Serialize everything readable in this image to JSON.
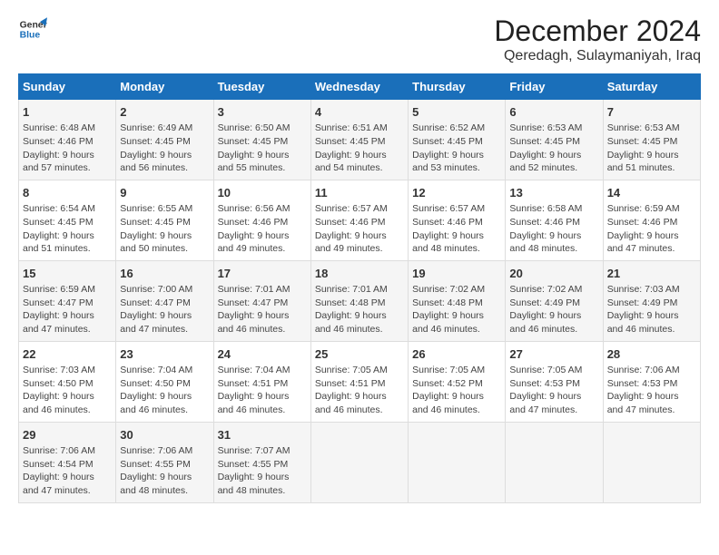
{
  "logo": {
    "line1": "General",
    "line2": "Blue"
  },
  "title": "December 2024",
  "subtitle": "Qeredagh, Sulaymaniyah, Iraq",
  "days_of_week": [
    "Sunday",
    "Monday",
    "Tuesday",
    "Wednesday",
    "Thursday",
    "Friday",
    "Saturday"
  ],
  "weeks": [
    [
      {
        "num": "1",
        "rise": "Sunrise: 6:48 AM",
        "set": "Sunset: 4:46 PM",
        "daylight": "Daylight: 9 hours and 57 minutes."
      },
      {
        "num": "2",
        "rise": "Sunrise: 6:49 AM",
        "set": "Sunset: 4:45 PM",
        "daylight": "Daylight: 9 hours and 56 minutes."
      },
      {
        "num": "3",
        "rise": "Sunrise: 6:50 AM",
        "set": "Sunset: 4:45 PM",
        "daylight": "Daylight: 9 hours and 55 minutes."
      },
      {
        "num": "4",
        "rise": "Sunrise: 6:51 AM",
        "set": "Sunset: 4:45 PM",
        "daylight": "Daylight: 9 hours and 54 minutes."
      },
      {
        "num": "5",
        "rise": "Sunrise: 6:52 AM",
        "set": "Sunset: 4:45 PM",
        "daylight": "Daylight: 9 hours and 53 minutes."
      },
      {
        "num": "6",
        "rise": "Sunrise: 6:53 AM",
        "set": "Sunset: 4:45 PM",
        "daylight": "Daylight: 9 hours and 52 minutes."
      },
      {
        "num": "7",
        "rise": "Sunrise: 6:53 AM",
        "set": "Sunset: 4:45 PM",
        "daylight": "Daylight: 9 hours and 51 minutes."
      }
    ],
    [
      {
        "num": "8",
        "rise": "Sunrise: 6:54 AM",
        "set": "Sunset: 4:45 PM",
        "daylight": "Daylight: 9 hours and 51 minutes."
      },
      {
        "num": "9",
        "rise": "Sunrise: 6:55 AM",
        "set": "Sunset: 4:45 PM",
        "daylight": "Daylight: 9 hours and 50 minutes."
      },
      {
        "num": "10",
        "rise": "Sunrise: 6:56 AM",
        "set": "Sunset: 4:46 PM",
        "daylight": "Daylight: 9 hours and 49 minutes."
      },
      {
        "num": "11",
        "rise": "Sunrise: 6:57 AM",
        "set": "Sunset: 4:46 PM",
        "daylight": "Daylight: 9 hours and 49 minutes."
      },
      {
        "num": "12",
        "rise": "Sunrise: 6:57 AM",
        "set": "Sunset: 4:46 PM",
        "daylight": "Daylight: 9 hours and 48 minutes."
      },
      {
        "num": "13",
        "rise": "Sunrise: 6:58 AM",
        "set": "Sunset: 4:46 PM",
        "daylight": "Daylight: 9 hours and 48 minutes."
      },
      {
        "num": "14",
        "rise": "Sunrise: 6:59 AM",
        "set": "Sunset: 4:46 PM",
        "daylight": "Daylight: 9 hours and 47 minutes."
      }
    ],
    [
      {
        "num": "15",
        "rise": "Sunrise: 6:59 AM",
        "set": "Sunset: 4:47 PM",
        "daylight": "Daylight: 9 hours and 47 minutes."
      },
      {
        "num": "16",
        "rise": "Sunrise: 7:00 AM",
        "set": "Sunset: 4:47 PM",
        "daylight": "Daylight: 9 hours and 47 minutes."
      },
      {
        "num": "17",
        "rise": "Sunrise: 7:01 AM",
        "set": "Sunset: 4:47 PM",
        "daylight": "Daylight: 9 hours and 46 minutes."
      },
      {
        "num": "18",
        "rise": "Sunrise: 7:01 AM",
        "set": "Sunset: 4:48 PM",
        "daylight": "Daylight: 9 hours and 46 minutes."
      },
      {
        "num": "19",
        "rise": "Sunrise: 7:02 AM",
        "set": "Sunset: 4:48 PM",
        "daylight": "Daylight: 9 hours and 46 minutes."
      },
      {
        "num": "20",
        "rise": "Sunrise: 7:02 AM",
        "set": "Sunset: 4:49 PM",
        "daylight": "Daylight: 9 hours and 46 minutes."
      },
      {
        "num": "21",
        "rise": "Sunrise: 7:03 AM",
        "set": "Sunset: 4:49 PM",
        "daylight": "Daylight: 9 hours and 46 minutes."
      }
    ],
    [
      {
        "num": "22",
        "rise": "Sunrise: 7:03 AM",
        "set": "Sunset: 4:50 PM",
        "daylight": "Daylight: 9 hours and 46 minutes."
      },
      {
        "num": "23",
        "rise": "Sunrise: 7:04 AM",
        "set": "Sunset: 4:50 PM",
        "daylight": "Daylight: 9 hours and 46 minutes."
      },
      {
        "num": "24",
        "rise": "Sunrise: 7:04 AM",
        "set": "Sunset: 4:51 PM",
        "daylight": "Daylight: 9 hours and 46 minutes."
      },
      {
        "num": "25",
        "rise": "Sunrise: 7:05 AM",
        "set": "Sunset: 4:51 PM",
        "daylight": "Daylight: 9 hours and 46 minutes."
      },
      {
        "num": "26",
        "rise": "Sunrise: 7:05 AM",
        "set": "Sunset: 4:52 PM",
        "daylight": "Daylight: 9 hours and 46 minutes."
      },
      {
        "num": "27",
        "rise": "Sunrise: 7:05 AM",
        "set": "Sunset: 4:53 PM",
        "daylight": "Daylight: 9 hours and 47 minutes."
      },
      {
        "num": "28",
        "rise": "Sunrise: 7:06 AM",
        "set": "Sunset: 4:53 PM",
        "daylight": "Daylight: 9 hours and 47 minutes."
      }
    ],
    [
      {
        "num": "29",
        "rise": "Sunrise: 7:06 AM",
        "set": "Sunset: 4:54 PM",
        "daylight": "Daylight: 9 hours and 47 minutes."
      },
      {
        "num": "30",
        "rise": "Sunrise: 7:06 AM",
        "set": "Sunset: 4:55 PM",
        "daylight": "Daylight: 9 hours and 48 minutes."
      },
      {
        "num": "31",
        "rise": "Sunrise: 7:07 AM",
        "set": "Sunset: 4:55 PM",
        "daylight": "Daylight: 9 hours and 48 minutes."
      },
      null,
      null,
      null,
      null
    ]
  ]
}
